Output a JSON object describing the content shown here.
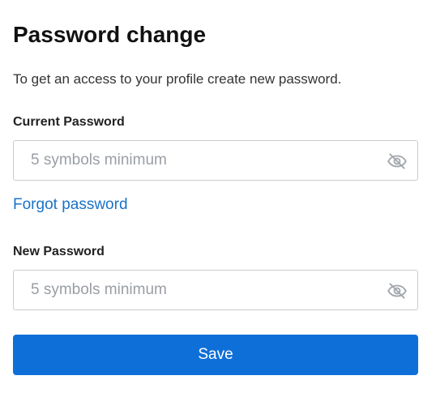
{
  "form": {
    "title": "Password change",
    "subtitle": "To get an access to your profile create new password.",
    "current_password": {
      "label": "Current Password",
      "placeholder": "5 symbols minimum",
      "value": ""
    },
    "forgot_link": "Forgot password",
    "new_password": {
      "label": "New Password",
      "placeholder": "5 symbols minimum",
      "value": ""
    },
    "save_label": "Save"
  },
  "icons": {
    "visibility_toggle": "eye-off-icon"
  },
  "colors": {
    "accent": "#0f6fd8",
    "link": "#1a73c8",
    "border": "#c9ccd1",
    "placeholder": "#9a9ea4"
  }
}
